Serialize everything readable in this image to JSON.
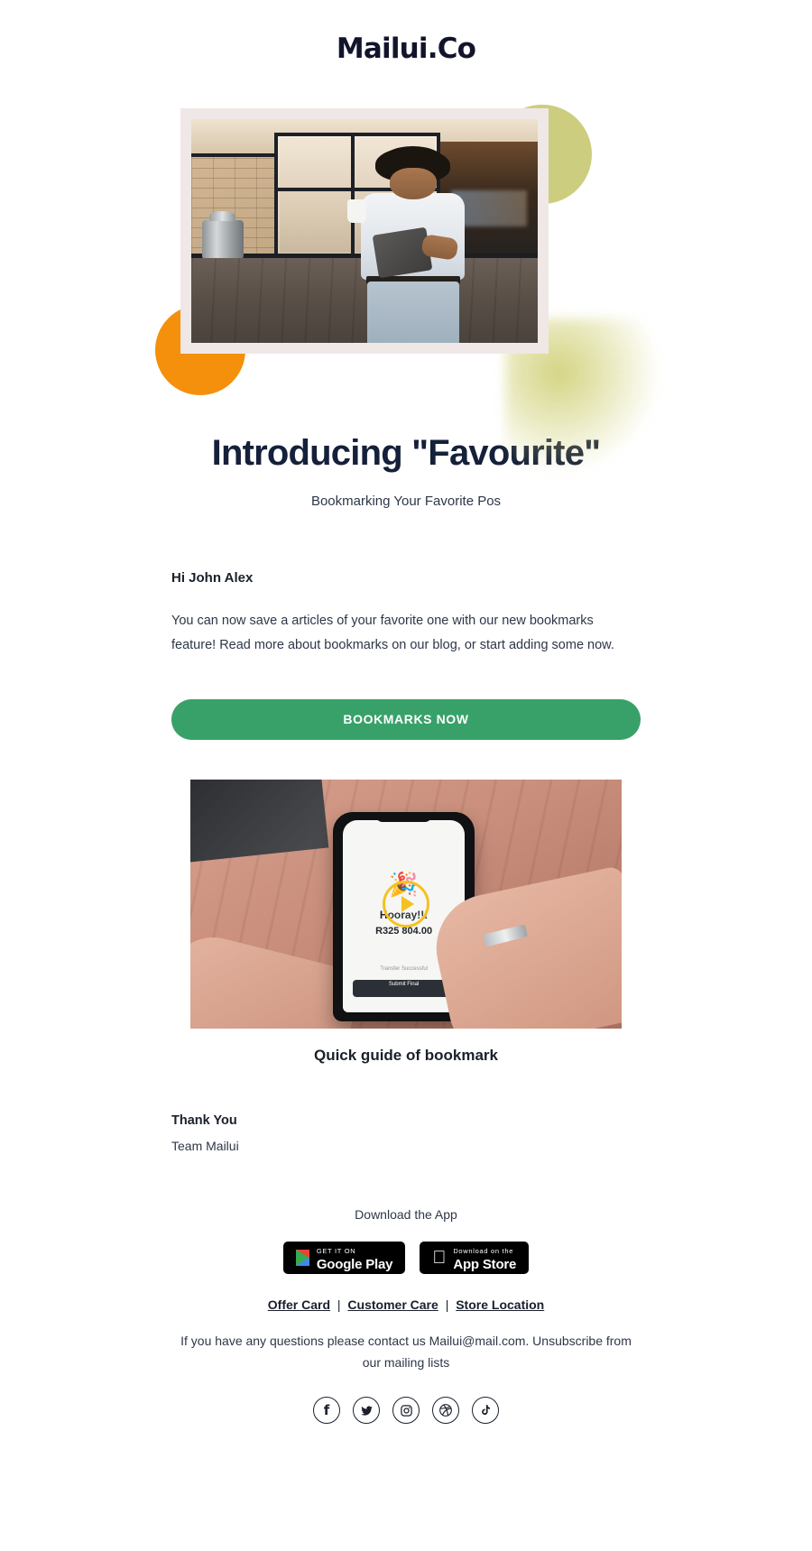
{
  "brand": {
    "logo": "Mailui.Co",
    "accent_green": "#38a169",
    "accent_orange": "#f4900c",
    "accent_olive": "#cdcd7f",
    "text_dark": "#15203a"
  },
  "hero": {
    "image_alt": "Man in white shirt holding coffee cup and tablet in a loft cafe",
    "frame_color": "#efe8e6"
  },
  "title": {
    "headline": "Introducing \"Favourite\"",
    "subtitle": "Bookmarking Your Favorite Pos"
  },
  "body": {
    "greeting": "Hi John Alex",
    "paragraph": "You can now save a articles of your favorite one with our new bookmarks feature! Read more about bookmarks on our blog, or start adding some now.",
    "cta_label": "BOOKMARKS NOW"
  },
  "video": {
    "caption": "Quick guide of bookmark",
    "phone_screen_title": "Hooray!!!",
    "phone_screen_amount": "R325 804.00",
    "phone_screen_small": "Transfer Successful",
    "phone_screen_button": "Submit Final",
    "confetti": "🎉",
    "play_color": "#f4c220"
  },
  "signoff": {
    "thanks": "Thank You",
    "team": "Team Mailui"
  },
  "footer": {
    "download_label": "Download the App",
    "badges": [
      {
        "top": "GET IT ON",
        "big": "Google Play",
        "icon": "google-play-icon"
      },
      {
        "top": "Download on the",
        "big": "App Store",
        "icon": "apple-icon"
      }
    ],
    "links": [
      {
        "label": "Offer Card"
      },
      {
        "label": "Customer Care"
      },
      {
        "label": "Store Location"
      }
    ],
    "link_separator": "|",
    "contact": "If you have any questions please contact us Mailui@mail.com. Unsubscribe from our mailing lists",
    "socials": [
      {
        "name": "facebook",
        "glyph": "f"
      },
      {
        "name": "twitter",
        "glyph": ""
      },
      {
        "name": "instagram",
        "glyph": ""
      },
      {
        "name": "dribbble",
        "glyph": ""
      },
      {
        "name": "tiktok",
        "glyph": ""
      }
    ]
  }
}
